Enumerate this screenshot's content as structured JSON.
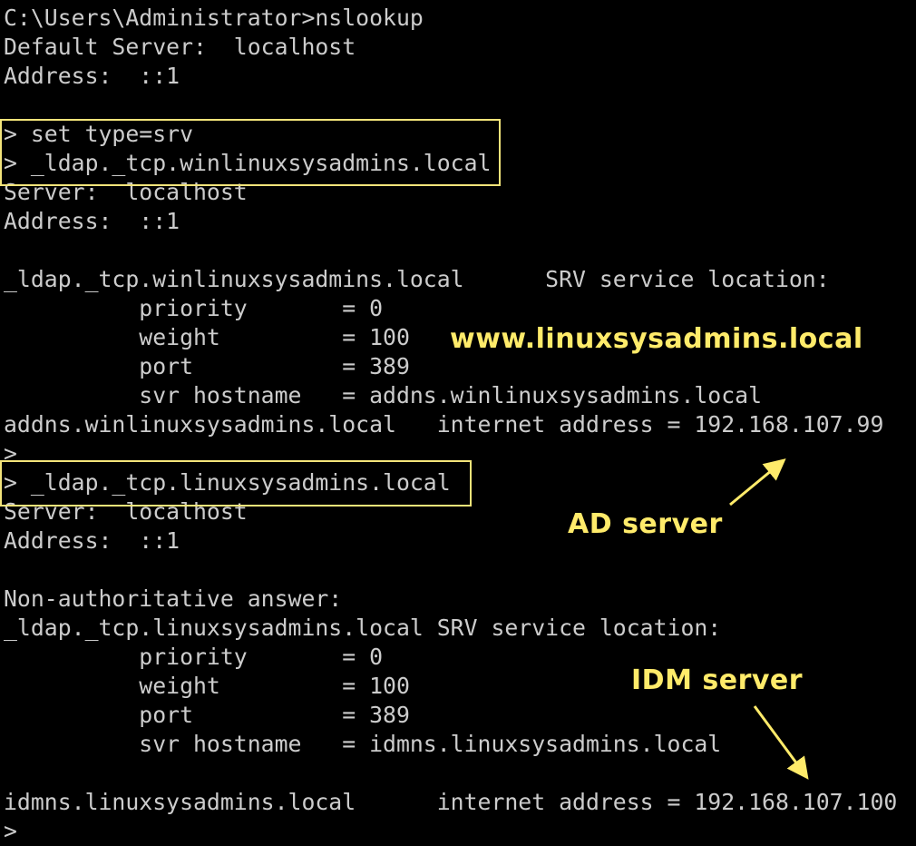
{
  "terminal": {
    "lines": [
      "C:\\Users\\Administrator>nslookup",
      "Default Server:  localhost",
      "Address:  ::1",
      "",
      "> set type=srv",
      "> _ldap._tcp.winlinuxsysadmins.local",
      "Server:  localhost",
      "Address:  ::1",
      "",
      "_ldap._tcp.winlinuxsysadmins.local      SRV service location:",
      "          priority       = 0",
      "          weight         = 100",
      "          port           = 389",
      "          svr hostname   = addns.winlinuxsysadmins.local",
      "addns.winlinuxsysadmins.local   internet address = 192.168.107.99",
      ">",
      "> _ldap._tcp.linuxsysadmins.local",
      "Server:  localhost",
      "Address:  ::1",
      "",
      "Non-authoritative answer:",
      "_ldap._tcp.linuxsysadmins.local SRV service location:",
      "          priority       = 0",
      "          weight         = 100",
      "          port           = 389",
      "          svr hostname   = idmns.linuxsysadmins.local",
      "",
      "idmns.linuxsysadmins.local      internet address = 192.168.107.100",
      ">"
    ]
  },
  "annotations": {
    "watermark": "www.linuxsysadmins.local",
    "ad_server": "AD server",
    "idm_server": "IDM server"
  },
  "colors": {
    "background": "#000000",
    "terminal_text": "#cccccc",
    "annotation": "#ffeb6a",
    "highlight_box": "#f3e47a"
  }
}
